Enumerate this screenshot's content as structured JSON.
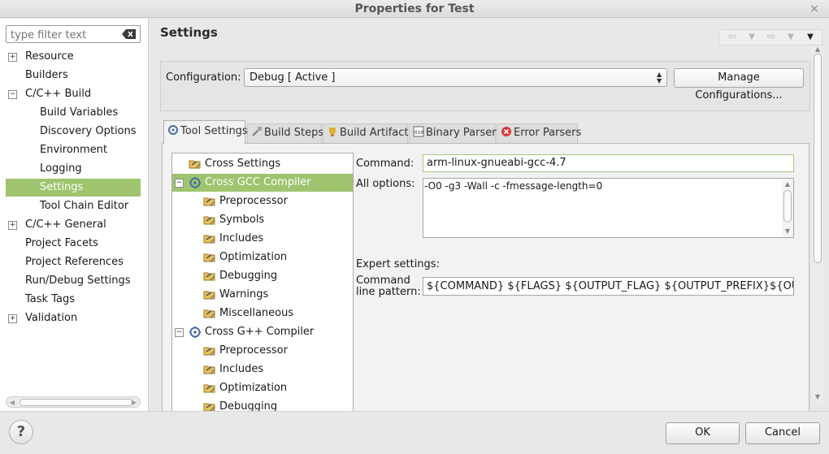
{
  "window": {
    "title": "Properties for Test",
    "close_glyph": "×"
  },
  "filter": {
    "placeholder": "type filter text"
  },
  "sidebar": {
    "items": [
      {
        "label": "Resource",
        "expander": "+"
      },
      {
        "label": "Builders"
      },
      {
        "label": "C/C++ Build",
        "expander": "−"
      },
      {
        "label": "Build Variables"
      },
      {
        "label": "Discovery Options"
      },
      {
        "label": "Environment"
      },
      {
        "label": "Logging"
      },
      {
        "label": "Settings",
        "selected": true
      },
      {
        "label": "Tool Chain Editor"
      },
      {
        "label": "C/C++ General",
        "expander": "+"
      },
      {
        "label": "Project Facets"
      },
      {
        "label": "Project References"
      },
      {
        "label": "Run/Debug Settings"
      },
      {
        "label": "Task Tags"
      },
      {
        "label": "Validation",
        "expander": "+"
      }
    ]
  },
  "page": {
    "title": "Settings"
  },
  "configuration": {
    "label": "Configuration:",
    "value": "Debug  [ Active ]",
    "manage_label": "Manage Configurations..."
  },
  "tabs": [
    {
      "label": "Tool Settings",
      "icon": "tool-settings-icon",
      "active": true
    },
    {
      "label": "Build Steps",
      "icon": "build-steps-icon"
    },
    {
      "label": "Build Artifact",
      "icon": "build-artifact-icon"
    },
    {
      "label": "Binary Parsers",
      "icon": "binary-parsers-icon"
    },
    {
      "label": "Error Parsers",
      "icon": "error-parsers-icon"
    }
  ],
  "tool_tree": [
    {
      "label": "Cross Settings"
    },
    {
      "label": "Cross GCC Compiler",
      "expander": "−",
      "selected": true
    },
    {
      "label": "Preprocessor"
    },
    {
      "label": "Symbols"
    },
    {
      "label": "Includes"
    },
    {
      "label": "Optimization"
    },
    {
      "label": "Debugging"
    },
    {
      "label": "Warnings"
    },
    {
      "label": "Miscellaneous"
    },
    {
      "label": "Cross G++ Compiler",
      "expander": "−"
    },
    {
      "label": "Preprocessor"
    },
    {
      "label": "Includes"
    },
    {
      "label": "Optimization"
    },
    {
      "label": "Debugging"
    }
  ],
  "fields": {
    "command_label": "Command:",
    "command_value": "arm-linux-gnueabi-gcc-4.7",
    "all_options_label": "All options:",
    "all_options_value": "-O0 -g3 -Wall -c -fmessage-length=0",
    "expert_label": "Expert settings:",
    "pattern_label_1": "Command",
    "pattern_label_2": "line pattern:",
    "pattern_value": "${COMMAND} ${FLAGS} ${OUTPUT_FLAG} ${OUTPUT_PREFIX}${OUTPUT}"
  },
  "buttons": {
    "help": "?",
    "ok": "OK",
    "cancel": "Cancel"
  },
  "colors": {
    "selection": "#9ec46e"
  }
}
